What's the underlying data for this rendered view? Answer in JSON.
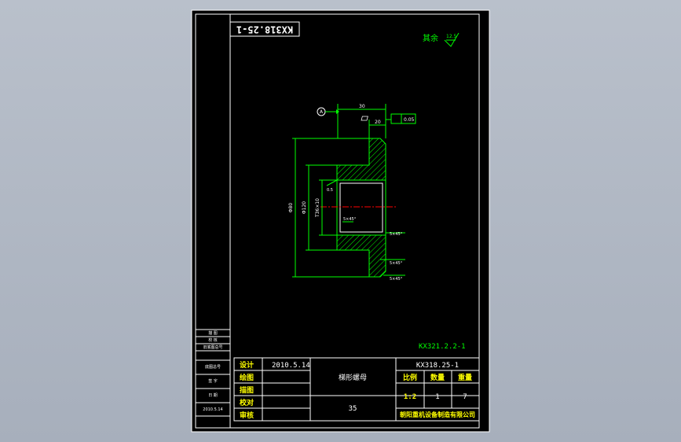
{
  "drawing": {
    "part_number_rotated": "KX318.25-1",
    "surface_note": "其余",
    "surface_roughness": "12.5",
    "datum_label": "A",
    "dims": {
      "top_overall": "30",
      "top_flange": "20",
      "tolerance_value": "0.05",
      "dia_outer": "Φ80",
      "dia_mid": "Φ120",
      "dia_thread": "T36×10",
      "bevel_small": "0.5",
      "chamfer_inner": "5×45°",
      "chamfer_1": "5×45°",
      "chamfer_2": "5×45°",
      "chamfer_3": "5×45°"
    },
    "drawing_ref": "KX321.2.2-1"
  },
  "side_strip": {
    "row1": "描 图",
    "row2": "校 核",
    "row3": "旧底图总号",
    "row4": "底图总号",
    "row5": "签 字",
    "row6": "日 期",
    "row7": "2010.5.14"
  },
  "title_block": {
    "roles": [
      "设计",
      "绘图",
      "描图",
      "校对",
      "审核"
    ],
    "date": "2010.5.14",
    "part_name": "梯形螺母",
    "material": "35",
    "drawing_no": "KX318.25-1",
    "headers": {
      "scale": "比例",
      "qty": "数量",
      "weight": "重量"
    },
    "values": {
      "scale": "1:2",
      "qty": "1",
      "weight": "7"
    },
    "company": "朝阳重机设备制造有限公司"
  },
  "colors": {
    "frame": "#ffffff",
    "geometry": "#00ff00",
    "dimensions": "#00ff00",
    "center_line": "#ff0000",
    "hatch": "#00ff00",
    "title_text": "#ffffff",
    "table_text": "#ffff00"
  }
}
